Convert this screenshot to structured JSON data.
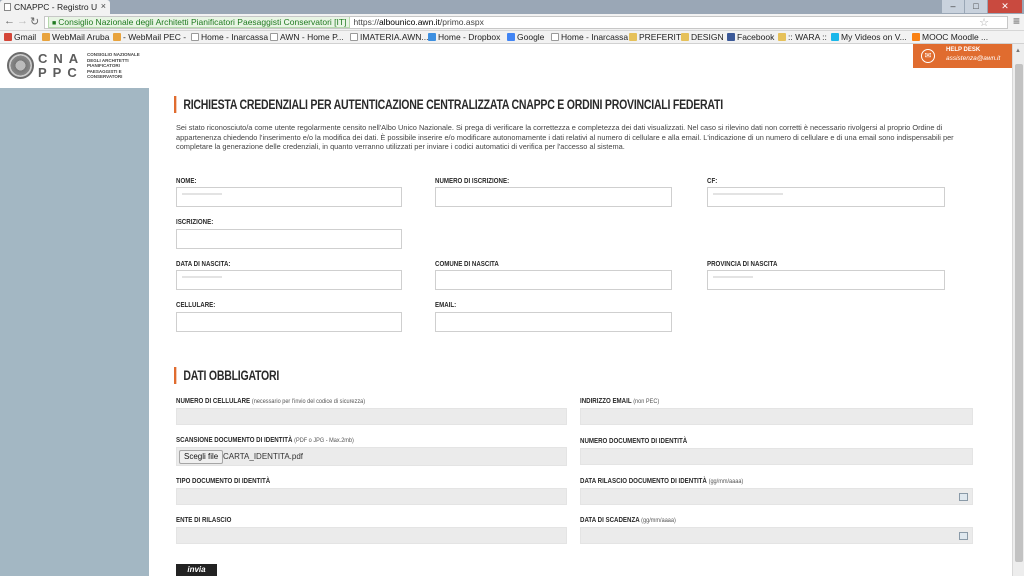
{
  "browser": {
    "tab_title": "CNAPPC - Registro U",
    "tab_close": "×",
    "secure_label": "Consiglio Nazionale degli Architetti Pianificatori Paesaggisti Conservatori [IT]",
    "url_scheme": "https://",
    "url_host": "albounico.awn.it",
    "url_path": "/primo.aspx",
    "bookmarks": [
      {
        "label": "Gmail",
        "color": "#d44638"
      },
      {
        "label": "WebMail Aruba",
        "color": "#e8a33d"
      },
      {
        "label": "- WebMail PEC -",
        "color": "#e8a33d"
      },
      {
        "label": "Home - Inarcassa",
        "color": "#9a9a9a"
      },
      {
        "label": "AWN - Home P...",
        "color": "#9a9a9a"
      },
      {
        "label": "IMATERIA.AWN...",
        "color": "#9a9a9a"
      },
      {
        "label": "Home - Dropbox",
        "color": "#3d8fe0"
      },
      {
        "label": "Google",
        "color": "#4285f4"
      },
      {
        "label": "Home - Inarcassa",
        "color": "#9a9a9a"
      },
      {
        "label": "PREFERITI",
        "color": "#e6c15a"
      },
      {
        "label": "DESIGN",
        "color": "#e6c15a"
      },
      {
        "label": "Facebook",
        "color": "#3b5998"
      },
      {
        "label": ":: WARA ::",
        "color": "#e6c15a"
      },
      {
        "label": "My Videos on V...",
        "color": "#1ab7ea"
      },
      {
        "label": "MOOC Moodle ...",
        "color": "#f98012"
      }
    ]
  },
  "logo": {
    "letters": "CNA PPC",
    "text": "CONSIGLIO NAZIONALE DEGLI ARCHITETTI PIANIFICATORI PAESAGGISTI E CONSERVATORI"
  },
  "helpdesk": {
    "label": "HELP DESK",
    "email": "assistenza@awn.it"
  },
  "form": {
    "title": "RICHIESTA CREDENZIALI PER AUTENTICAZIONE CENTRALIZZATA CNAPPC E ORDINI PROVINCIALI FEDERATI",
    "intro": "Sei stato riconosciuto/a come utente regolarmente censito nell'Albo Unico Nazionale. Si prega di verificare la correttezza e completezza dei dati visualizzati. Nel caso si rilevino dati non corretti è necessario rivolgersi al proprio Ordine di appartenenza chiedendo l'inserimento e/o la modifica dei dati. È possibile inserire e/o modificare autonomamente i dati relativi al numero di cellulare e alla email. L'indicazione di un numero di cellulare e di una email sono indispensabili per completare la generazione delle credenziali, in quanto verranno utilizzati per inviare i codici automatici di verifica per l'accesso al sistema.",
    "labels": {
      "nome": "NOME:",
      "numero_iscrizione": "NUMERO DI ISCRIZIONE:",
      "cf": "CF:",
      "iscrizione": "ISCRIZIONE:",
      "data_nascita": "DATA DI NASCITA:",
      "comune_nascita": "COMUNE DI NASCITA",
      "provincia_nascita": "PROVINCIA DI NASCITA",
      "cellulare": "CELLULARE:",
      "email": "EMAIL:"
    }
  },
  "obbligatori": {
    "title": "DATI OBBLIGATORI",
    "labels": {
      "numero_cellulare": "NUMERO DI CELLULARE",
      "numero_cellulare_note": "(necessario per l'invio del codice di sicurezza)",
      "indirizzo_email": "INDIRIZZO EMAIL",
      "indirizzo_email_note": "(non PEC)",
      "scansione": "SCANSIONE DOCUMENTO DI IDENTITÀ",
      "scansione_note": "(PDF o JPG - Max.2mb)",
      "numero_documento": "NUMERO DOCUMENTO DI IDENTITÀ",
      "tipo_documento": "TIPO DOCUMENTO DI IDENTITÀ",
      "data_rilascio": "DATA RILASCIO DOCUMENTO DI IDENTITÀ",
      "data_rilascio_note": "(gg/mm/aaaa)",
      "ente_rilascio": "ENTE DI RILASCIO",
      "data_scadenza": "DATA DI SCADENZA",
      "data_scadenza_note": "(gg/mm/aaaa)"
    },
    "file_button": "Scegli file",
    "file_name": "CARTA_IDENTITA.pdf"
  },
  "submit_label": "invia"
}
